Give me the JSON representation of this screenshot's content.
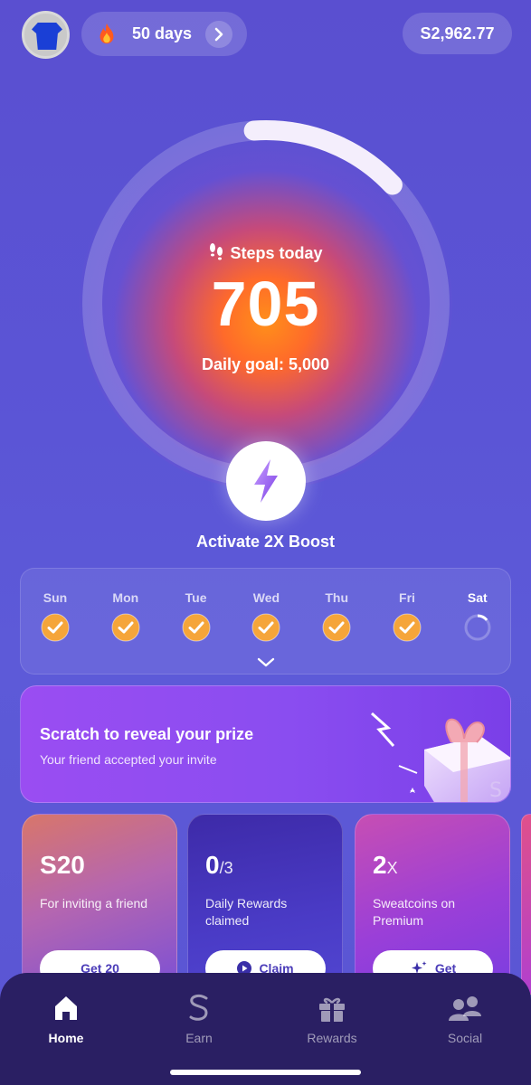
{
  "header": {
    "streak_text": "50 days",
    "balance_prefix": "S",
    "balance": "2,962.77",
    "icons": [
      "avatar",
      "fire-icon",
      "chevron-right-icon",
      "sweatcoin-icon"
    ]
  },
  "steps": {
    "label": "Steps today",
    "value": "705",
    "goal_text": "Daily goal: 5,000",
    "progress": 0.141
  },
  "boost": {
    "label": "Activate 2X Boost"
  },
  "week": {
    "days": [
      {
        "label": "Sun",
        "status": "done"
      },
      {
        "label": "Mon",
        "status": "done"
      },
      {
        "label": "Tue",
        "status": "done"
      },
      {
        "label": "Wed",
        "status": "done"
      },
      {
        "label": "Thu",
        "status": "done"
      },
      {
        "label": "Fri",
        "status": "done"
      },
      {
        "label": "Sat",
        "status": "in-progress"
      }
    ]
  },
  "banner": {
    "title": "Scratch to reveal your prize",
    "subtitle": "Your friend accepted your invite"
  },
  "cards": [
    {
      "big": "20",
      "big_prefix": "S",
      "small": "",
      "desc": "For inviting a friend",
      "cta": "Get 20",
      "cta_icon": "sweatcoin-icon"
    },
    {
      "big": "0",
      "small": "/3",
      "desc": "Daily Rewards claimed",
      "cta": "Claim",
      "cta_icon": "play-icon"
    },
    {
      "big": "2",
      "small": "X",
      "desc": "Sweatcoins on Premium",
      "cta": "Get",
      "cta_icon": "sparkle-icon"
    }
  ],
  "nav": {
    "items": [
      {
        "label": "Home",
        "icon": "home-icon",
        "active": true
      },
      {
        "label": "Earn",
        "icon": "sweatcoin-icon",
        "active": false
      },
      {
        "label": "Rewards",
        "icon": "gift-icon",
        "active": false
      },
      {
        "label": "Social",
        "icon": "people-icon",
        "active": false
      }
    ]
  },
  "colors": {
    "background": "#5a55d3",
    "check": "#f5a53a",
    "nav_bg": "#2a1f63"
  }
}
